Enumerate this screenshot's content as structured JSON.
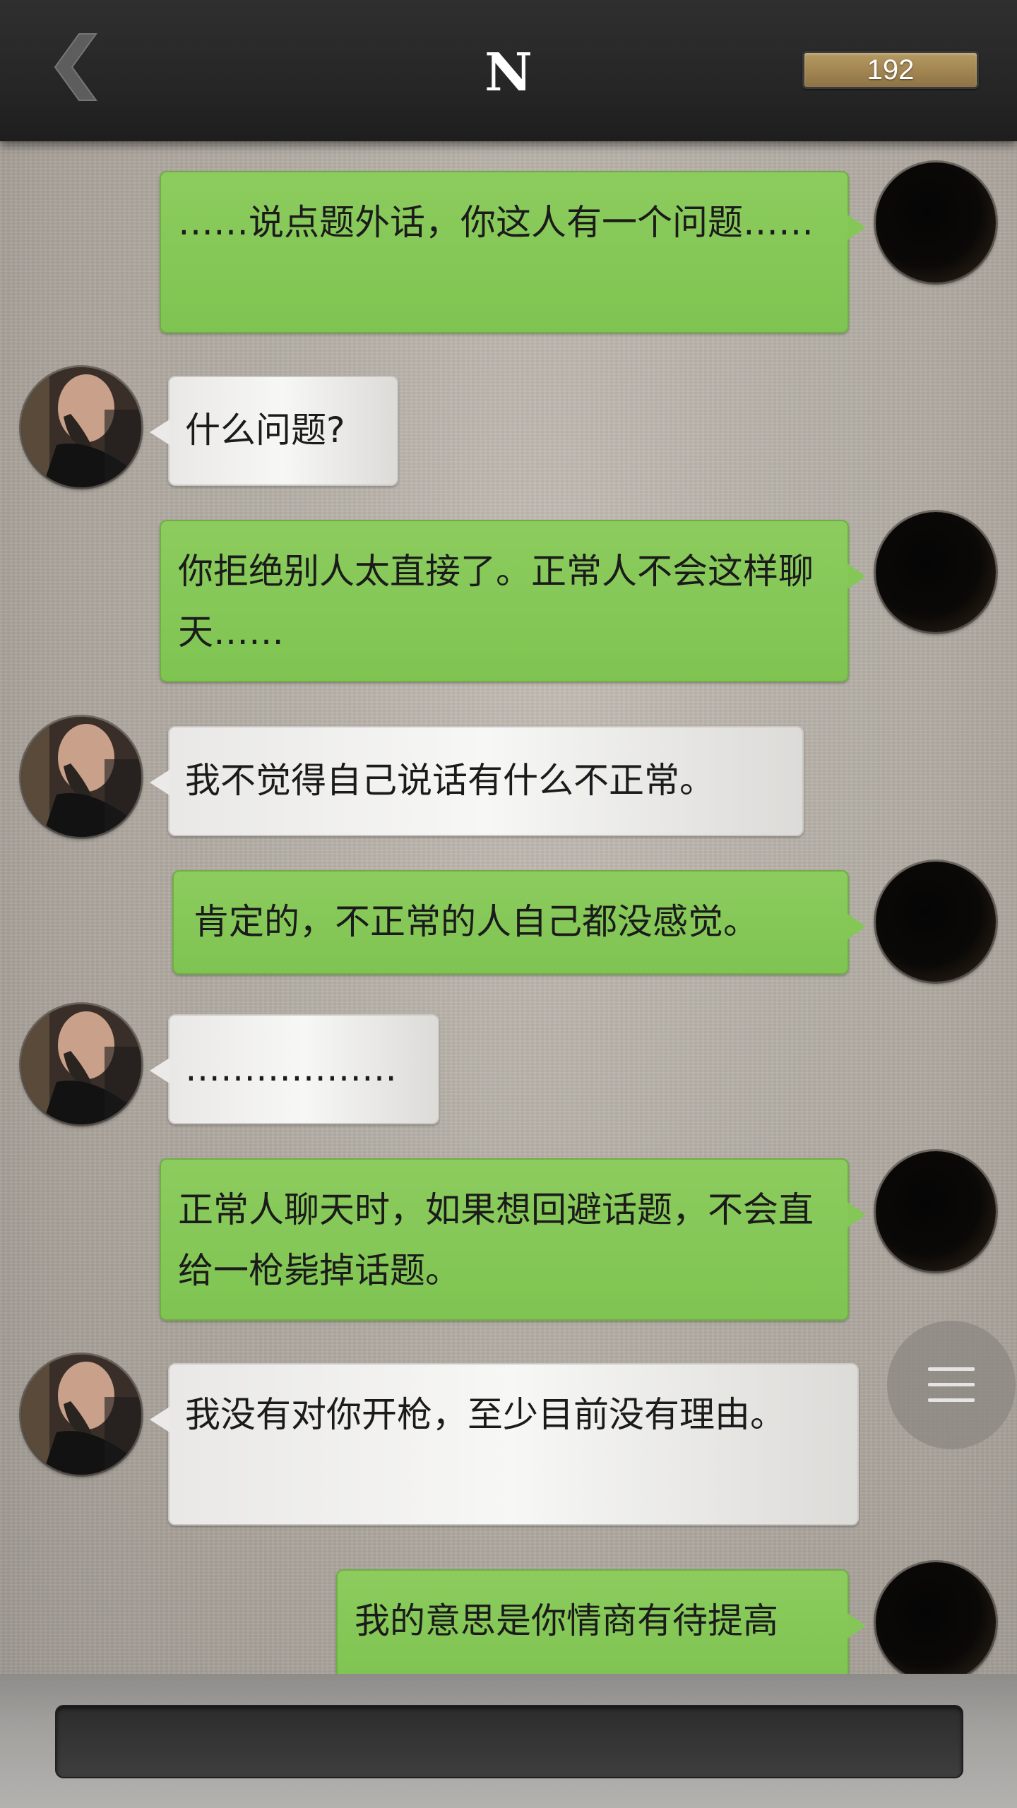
{
  "header": {
    "title": "N",
    "counter": "192",
    "back_icon": "chevron-left-icon"
  },
  "messages": [
    {
      "side": "out",
      "text": "……说点题外话，你这人有一个问题……"
    },
    {
      "side": "in",
      "text": "什么问题?"
    },
    {
      "side": "out",
      "text": "你拒绝别人太直接了。正常人不会这样聊天……"
    },
    {
      "side": "in",
      "text": "我不觉得自己说话有什么不正常。"
    },
    {
      "side": "out",
      "text": "肯定的，不正常的人自己都没感觉。"
    },
    {
      "side": "in",
      "text": "………………"
    },
    {
      "side": "out",
      "text": "正常人聊天时，如果想回避话题，不会直给一枪毙掉话题。"
    },
    {
      "side": "in",
      "text": "我没有对你开枪，至少目前没有理由。"
    },
    {
      "side": "out",
      "text": "我的意思是你情商有待提高"
    }
  ],
  "menu": {
    "icon": "menu-icon"
  },
  "input": {
    "value": ""
  }
}
